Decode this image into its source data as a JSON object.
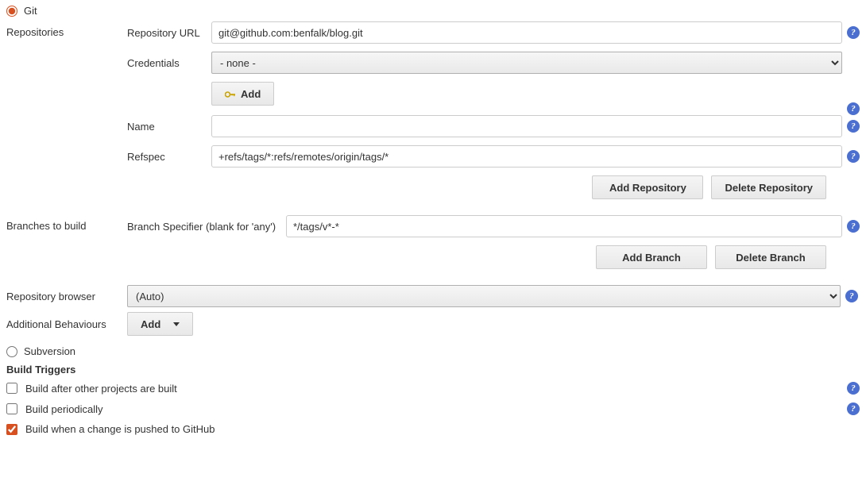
{
  "scm": {
    "git_label": "Git",
    "svn_label": "Subversion"
  },
  "repositories": {
    "label": "Repositories",
    "url_label": "Repository URL",
    "url_value": "git@github.com:benfalk/blog.git",
    "credentials_label": "Credentials",
    "credentials_value": "- none -",
    "add_label": "Add",
    "name_label": "Name",
    "name_value": "",
    "refspec_label": "Refspec",
    "refspec_value": "+refs/tags/*:refs/remotes/origin/tags/*",
    "add_repo_btn": "Add Repository",
    "delete_repo_btn": "Delete Repository"
  },
  "branches": {
    "label": "Branches to build",
    "specifier_label": "Branch Specifier (blank for 'any')",
    "specifier_value": "*/tags/v*-*",
    "add_branch_btn": "Add Branch",
    "delete_branch_btn": "Delete Branch"
  },
  "browser": {
    "label": "Repository browser",
    "value": "(Auto)"
  },
  "behaviours": {
    "label": "Additional Behaviours",
    "add_btn": "Add"
  },
  "triggers": {
    "header": "Build Triggers",
    "after_projects": "Build after other projects are built",
    "periodically": "Build periodically",
    "github_push": "Build when a change is pushed to GitHub"
  }
}
